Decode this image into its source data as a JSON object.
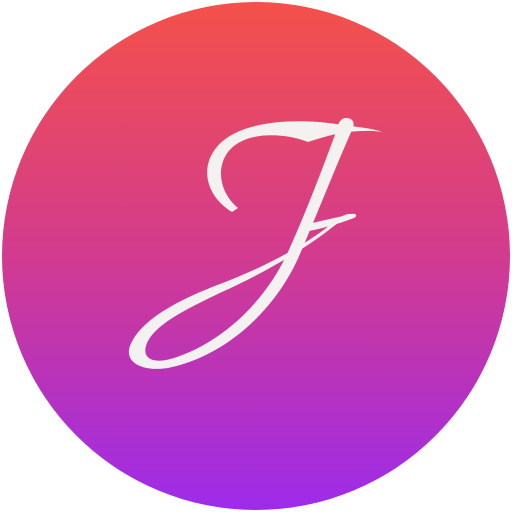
{
  "icon": {
    "name": "script-letter-j-icon",
    "monogram": "J",
    "colors": {
      "gradient_top": "#F45149",
      "gradient_mid": "#D23B8F",
      "gradient_bottom": "#9D2BEA",
      "glyph": "#F4F1F1"
    }
  }
}
